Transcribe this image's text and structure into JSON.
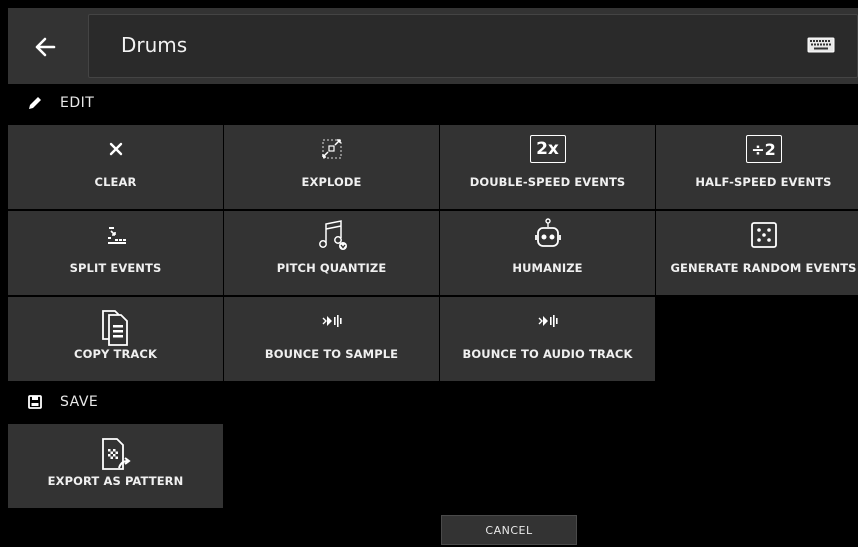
{
  "header": {
    "title": "Drums",
    "back_icon": "arrow-left-icon",
    "keyboard_icon": "keyboard-icon"
  },
  "edit_section": {
    "label": "EDIT",
    "icon": "pencil-icon"
  },
  "edit_actions": [
    {
      "label": "CLEAR",
      "icon": "close-icon"
    },
    {
      "label": "EXPLODE",
      "icon": "explode-icon"
    },
    {
      "label": "DOUBLE-SPEED EVENTS",
      "icon": "double-speed-icon",
      "icon_text": "2x"
    },
    {
      "label": "HALF-SPEED EVENTS",
      "icon": "half-speed-icon",
      "icon_text": "÷2"
    },
    {
      "label": "SPLIT EVENTS",
      "icon": "split-events-icon"
    },
    {
      "label": "PITCH QUANTIZE",
      "icon": "pitch-quantize-icon"
    },
    {
      "label": "HUMANIZE",
      "icon": "robot-icon"
    },
    {
      "label": "GENERATE RANDOM EVENTS",
      "icon": "dice-icon"
    },
    {
      "label": "COPY TRACK",
      "icon": "copy-track-icon"
    },
    {
      "label": "BOUNCE TO SAMPLE",
      "icon": "bounce-icon"
    },
    {
      "label": "BOUNCE TO AUDIO TRACK",
      "icon": "bounce-icon"
    }
  ],
  "save_section": {
    "label": "SAVE",
    "icon": "floppy-icon"
  },
  "save_actions": [
    {
      "label": "EXPORT AS PATTERN",
      "icon": "export-pattern-icon"
    }
  ],
  "footer": {
    "cancel_label": "CANCEL"
  },
  "colors": {
    "background": "#000000",
    "tile": "#333333",
    "text": "#ffffff"
  }
}
